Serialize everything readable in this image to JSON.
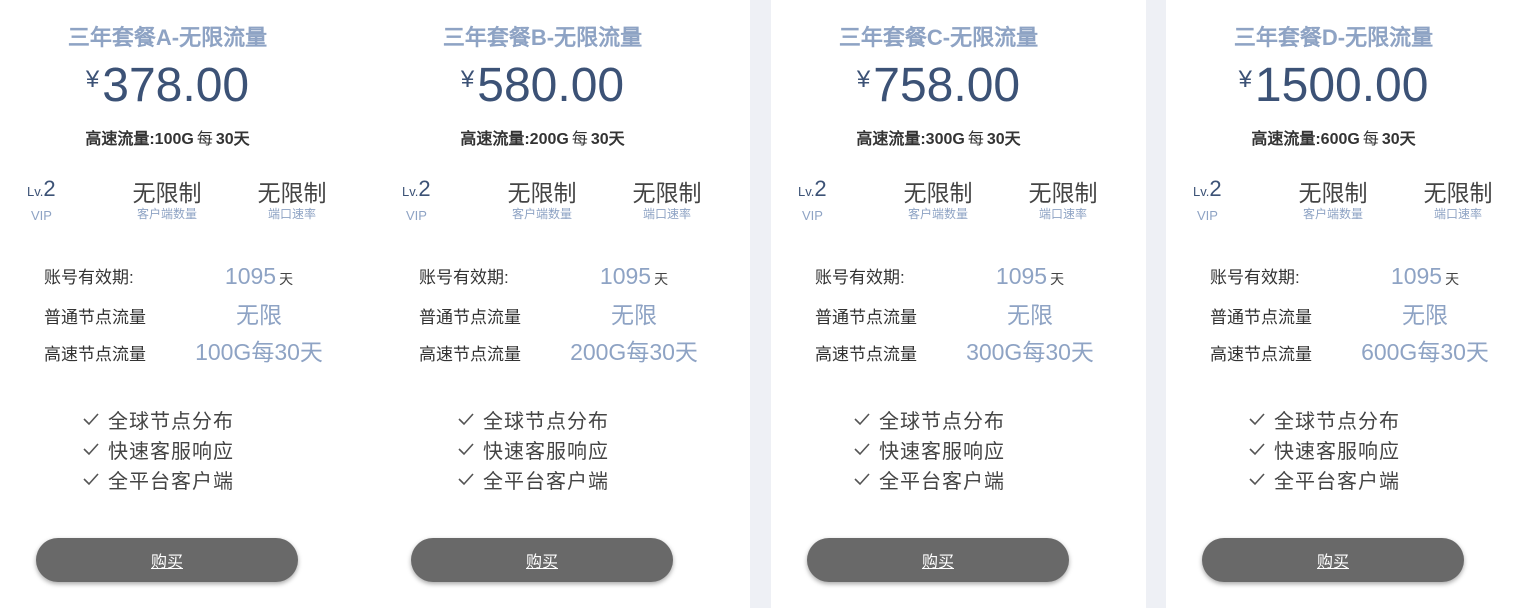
{
  "plans": [
    {
      "title": "三年套餐A-无限流量",
      "currency": "¥",
      "price": "378.00",
      "quota": {
        "prefix": "高速流量:100G",
        "every": "每",
        "period": "30天"
      },
      "level": {
        "prefix": "Lv.",
        "number": "2",
        "tag": "VIP"
      },
      "features": [
        {
          "value": "无限制",
          "label": "客户端数量"
        },
        {
          "value": "无限制",
          "label": "端口速率"
        }
      ],
      "details": [
        {
          "label": "账号有效期:",
          "value": "1095",
          "unit": "天"
        },
        {
          "label": "普通节点流量",
          "value": "无限"
        },
        {
          "label": "高速节点流量",
          "value": "100G每30天"
        }
      ],
      "checks": [
        "全球节点分布",
        "快速客服响应",
        "全平台客户端"
      ],
      "button": "购买"
    },
    {
      "title": "三年套餐B-无限流量",
      "currency": "¥",
      "price": "580.00",
      "quota": {
        "prefix": "高速流量:200G",
        "every": "每",
        "period": "30天"
      },
      "level": {
        "prefix": "Lv.",
        "number": "2",
        "tag": "VIP"
      },
      "features": [
        {
          "value": "无限制",
          "label": "客户端数量"
        },
        {
          "value": "无限制",
          "label": "端口速率"
        }
      ],
      "details": [
        {
          "label": "账号有效期:",
          "value": "1095",
          "unit": "天"
        },
        {
          "label": "普通节点流量",
          "value": "无限"
        },
        {
          "label": "高速节点流量",
          "value": "200G每30天"
        }
      ],
      "checks": [
        "全球节点分布",
        "快速客服响应",
        "全平台客户端"
      ],
      "button": "购买"
    },
    {
      "title": "三年套餐C-无限流量",
      "currency": "¥",
      "price": "758.00",
      "quota": {
        "prefix": "高速流量:300G",
        "every": "每",
        "period": "30天"
      },
      "level": {
        "prefix": "Lv.",
        "number": "2",
        "tag": "VIP"
      },
      "features": [
        {
          "value": "无限制",
          "label": "客户端数量"
        },
        {
          "value": "无限制",
          "label": "端口速率"
        }
      ],
      "details": [
        {
          "label": "账号有效期:",
          "value": "1095",
          "unit": "天"
        },
        {
          "label": "普通节点流量",
          "value": "无限"
        },
        {
          "label": "高速节点流量",
          "value": "300G每30天"
        }
      ],
      "checks": [
        "全球节点分布",
        "快速客服响应",
        "全平台客户端"
      ],
      "button": "购买"
    },
    {
      "title": "三年套餐D-无限流量",
      "currency": "¥",
      "price": "1500.00",
      "quota": {
        "prefix": "高速流量:600G",
        "every": "每",
        "period": "30天"
      },
      "level": {
        "prefix": "Lv.",
        "number": "2",
        "tag": "VIP"
      },
      "features": [
        {
          "value": "无限制",
          "label": "客户端数量"
        },
        {
          "value": "无限制",
          "label": "端口速率"
        }
      ],
      "details": [
        {
          "label": "账号有效期:",
          "value": "1095",
          "unit": "天"
        },
        {
          "label": "普通节点流量",
          "value": "无限"
        },
        {
          "label": "高速节点流量",
          "value": "600G每30天"
        }
      ],
      "checks": [
        "全球节点分布",
        "快速客服响应",
        "全平台客户端"
      ],
      "button": "购买"
    }
  ],
  "colors": {
    "page_bg": "#eef0f5",
    "card_bg": "#ffffff",
    "title": "#8ea3c4",
    "price": "#3c5276",
    "button_bg": "#696969",
    "button_text": "#ffffff"
  },
  "icons": {
    "check": "checkmark-icon"
  }
}
